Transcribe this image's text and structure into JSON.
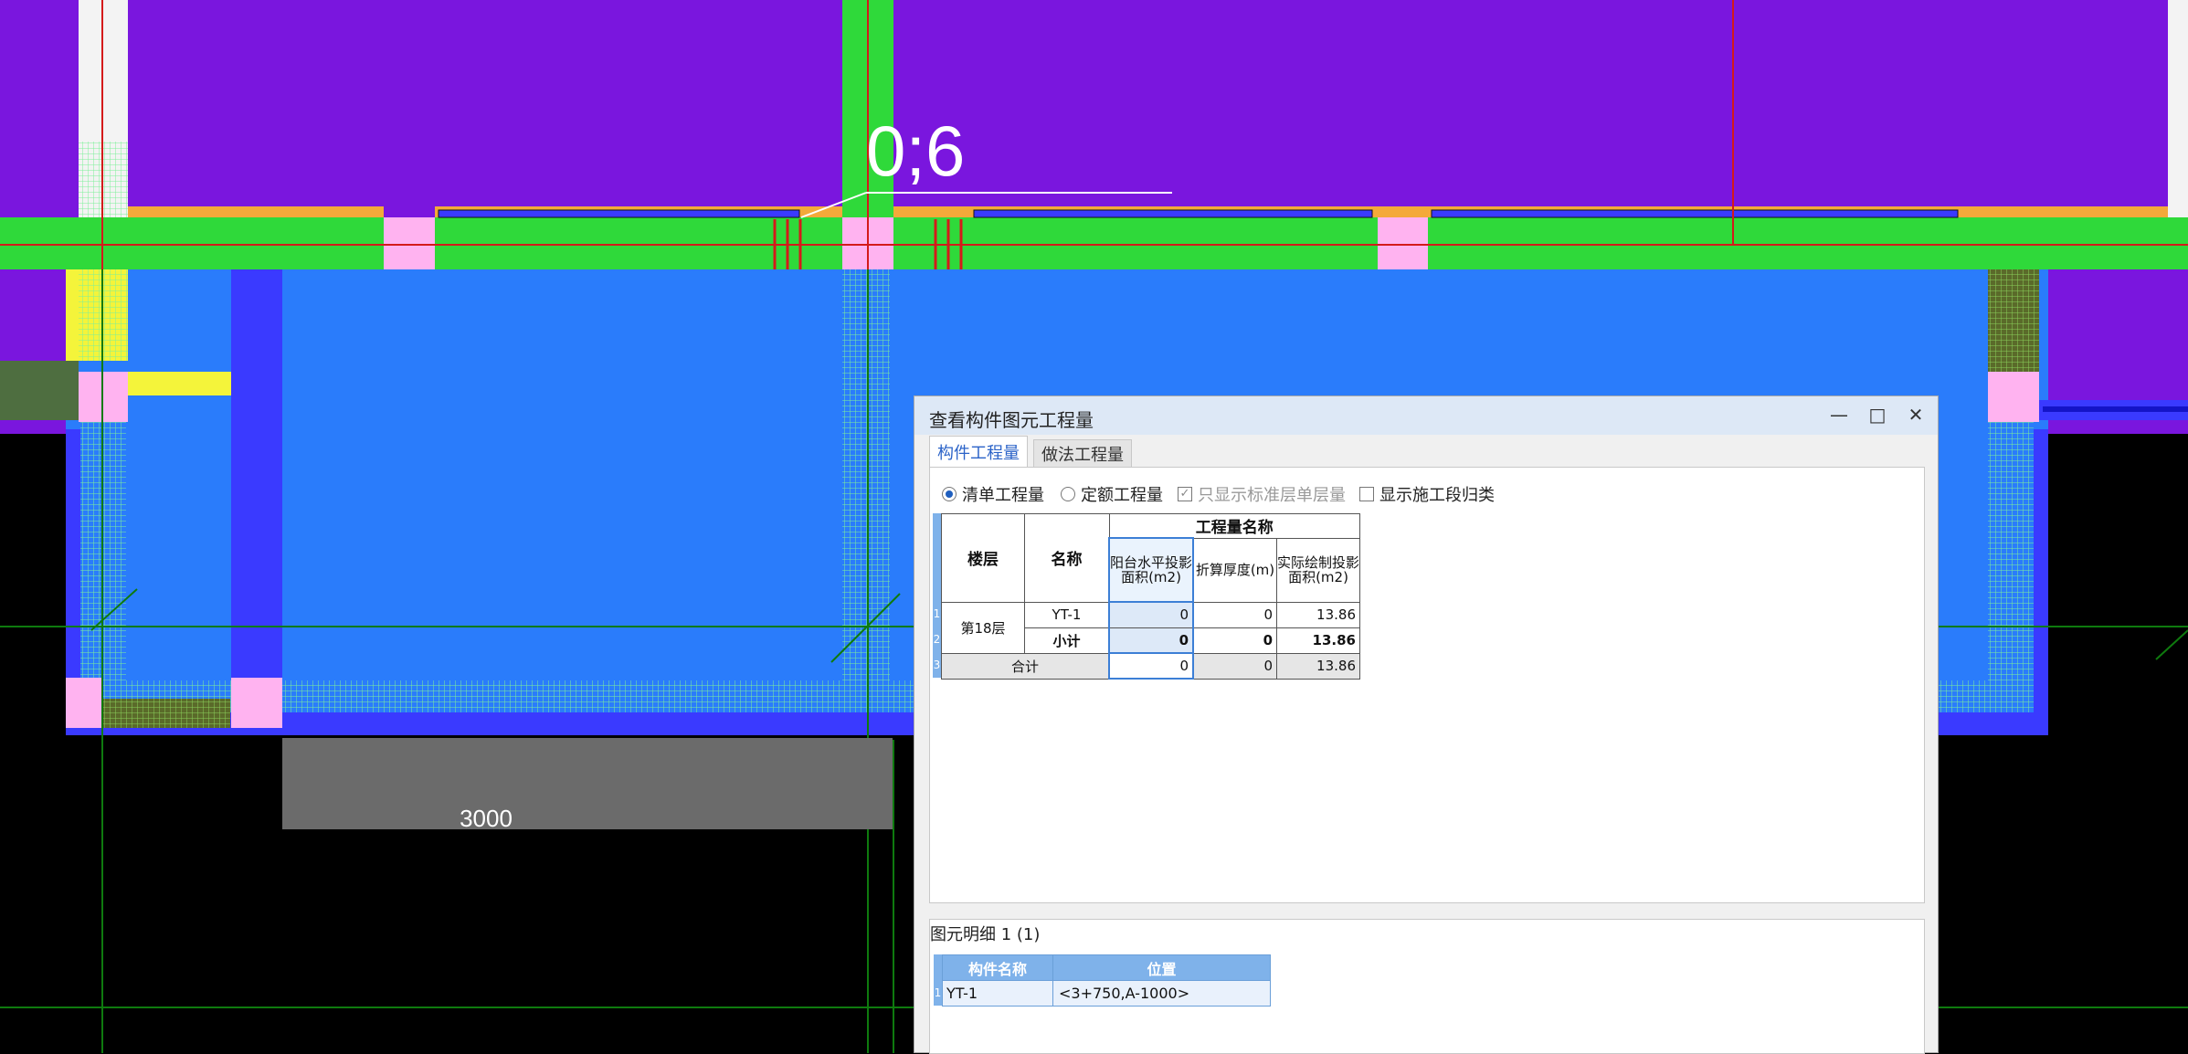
{
  "drawing": {
    "axis_label": "0;6",
    "dimension_label": "3000"
  },
  "dialog": {
    "title": "查看构件图元工程量",
    "minimize_icon": "minimize-icon",
    "maximize_icon": "maximize-icon",
    "close_icon": "close-icon",
    "tabs": [
      "构件工程量",
      "做法工程量"
    ],
    "options": {
      "radio_bill": "清单工程量",
      "radio_quota": "定额工程量",
      "check_standard_floor": "只显示标准层单层量",
      "check_section_group": "显示施工段归类"
    },
    "table": {
      "header_floor": "楼层",
      "header_name": "名称",
      "header_group": "工程量名称",
      "col1": "阳台水平投影面积(m2)",
      "col2": "折算厚度(m)",
      "col3": "实际绘制投影面积(m2)",
      "rows": [
        {
          "index": "1",
          "floor": "第18层",
          "name": "YT-1",
          "v1": "0",
          "v2": "0",
          "v3": "13.86"
        },
        {
          "index": "2",
          "floor": "",
          "name": "小计",
          "v1": "0",
          "v2": "0",
          "v3": "13.86"
        },
        {
          "index": "3",
          "floor": "",
          "name": "合计",
          "v1": "0",
          "v2": "0",
          "v3": "13.86"
        }
      ]
    },
    "detail": {
      "title": "图元明细  1 (1)",
      "header_name": "构件名称",
      "header_position": "位置",
      "rows": [
        {
          "index": "1",
          "name": "YT-1",
          "position": "<3+750,A-1000>"
        }
      ]
    }
  },
  "colors": {
    "wall_purple": "#7a16de",
    "beam_green": "#2fd93a",
    "slab_blue": "#2a7cfb",
    "column_pink": "#ffb3f0",
    "dialog_header_blue": "#7fb2ea"
  }
}
